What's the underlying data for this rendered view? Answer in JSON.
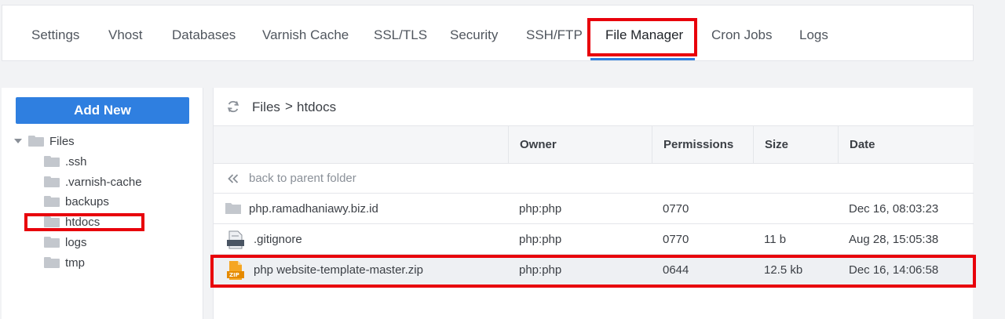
{
  "tabs": [
    {
      "label": "Settings",
      "name": "tab-settings"
    },
    {
      "label": "Vhost",
      "name": "tab-vhost"
    },
    {
      "label": "Databases",
      "name": "tab-databases"
    },
    {
      "label": "Varnish Cache",
      "name": "tab-varnish-cache"
    },
    {
      "label": "SSL/TLS",
      "name": "tab-ssl-tls"
    },
    {
      "label": "Security",
      "name": "tab-security"
    },
    {
      "label": "SSH/FTP",
      "name": "tab-ssh-ftp"
    },
    {
      "label": "File Manager",
      "name": "tab-file-manager",
      "active": true
    },
    {
      "label": "Cron Jobs",
      "name": "tab-cron-jobs"
    },
    {
      "label": "Logs",
      "name": "tab-logs"
    }
  ],
  "sidebar": {
    "add_new_label": "Add New",
    "root_label": "Files",
    "folders": [
      ".ssh",
      ".varnish-cache",
      "backups",
      "htdocs",
      "logs",
      "tmp"
    ]
  },
  "breadcrumb": {
    "root": "Files",
    "separator": ">",
    "current": "htdocs"
  },
  "table": {
    "columns": [
      "Owner",
      "Permissions",
      "Size",
      "Date"
    ],
    "back_label": "back to parent folder",
    "rows": [
      {
        "icon": "folder-icon",
        "name": "php.ramadhaniawy.biz.id",
        "owner": "php:php",
        "permissions": "0770",
        "size": "",
        "date": "Dec 16, 08:03:23"
      },
      {
        "icon": "text-file-icon",
        "name": ".gitignore",
        "owner": "php:php",
        "permissions": "0770",
        "size": "11 b",
        "date": "Aug 28, 15:05:38"
      },
      {
        "icon": "zip-file-icon",
        "name": "php website-template-master.zip",
        "owner": "php:php",
        "permissions": "0644",
        "size": "12.5 kb",
        "date": "Dec 16, 14:06:58",
        "selected": true
      }
    ],
    "zip_badge": "ZIP"
  },
  "colors": {
    "accent": "#2f7fe0",
    "highlight": "#e8000b"
  }
}
